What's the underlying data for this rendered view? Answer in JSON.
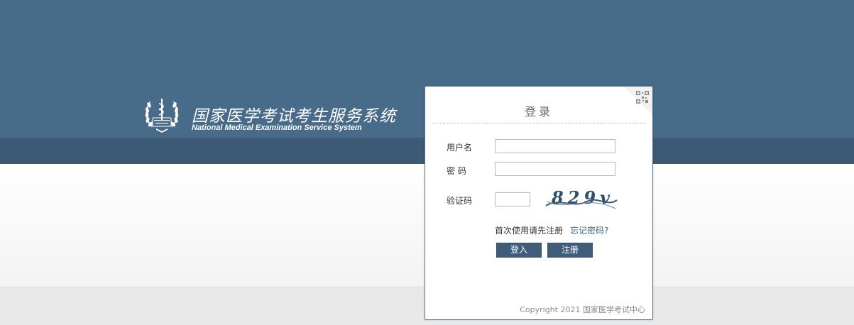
{
  "brand": {
    "title": "国家医学考试考生服务系统",
    "subtitle": "National Medical Examination Service System",
    "emblem_icon": "caduceus-wreath-emblem-icon"
  },
  "login": {
    "title": "登录",
    "qr_icon": "qr-code-icon",
    "username_label": "用户名",
    "username_value": "",
    "password_label": "密 码",
    "password_value": "",
    "captcha_label": "验证码",
    "captcha_value": "",
    "captcha_image_text": "829v",
    "first_use_hint": "首次使用请先注册",
    "forgot_password": "忘记密码?",
    "login_button": "登入",
    "register_button": "注册",
    "copyright": "Copyright 2021 国家医学考试中心"
  },
  "colors": {
    "header_blue": "#486b8a",
    "header_dark_band": "#3c5a75",
    "button_blue": "#3f5d7a",
    "link_blue": "#3d6488"
  }
}
